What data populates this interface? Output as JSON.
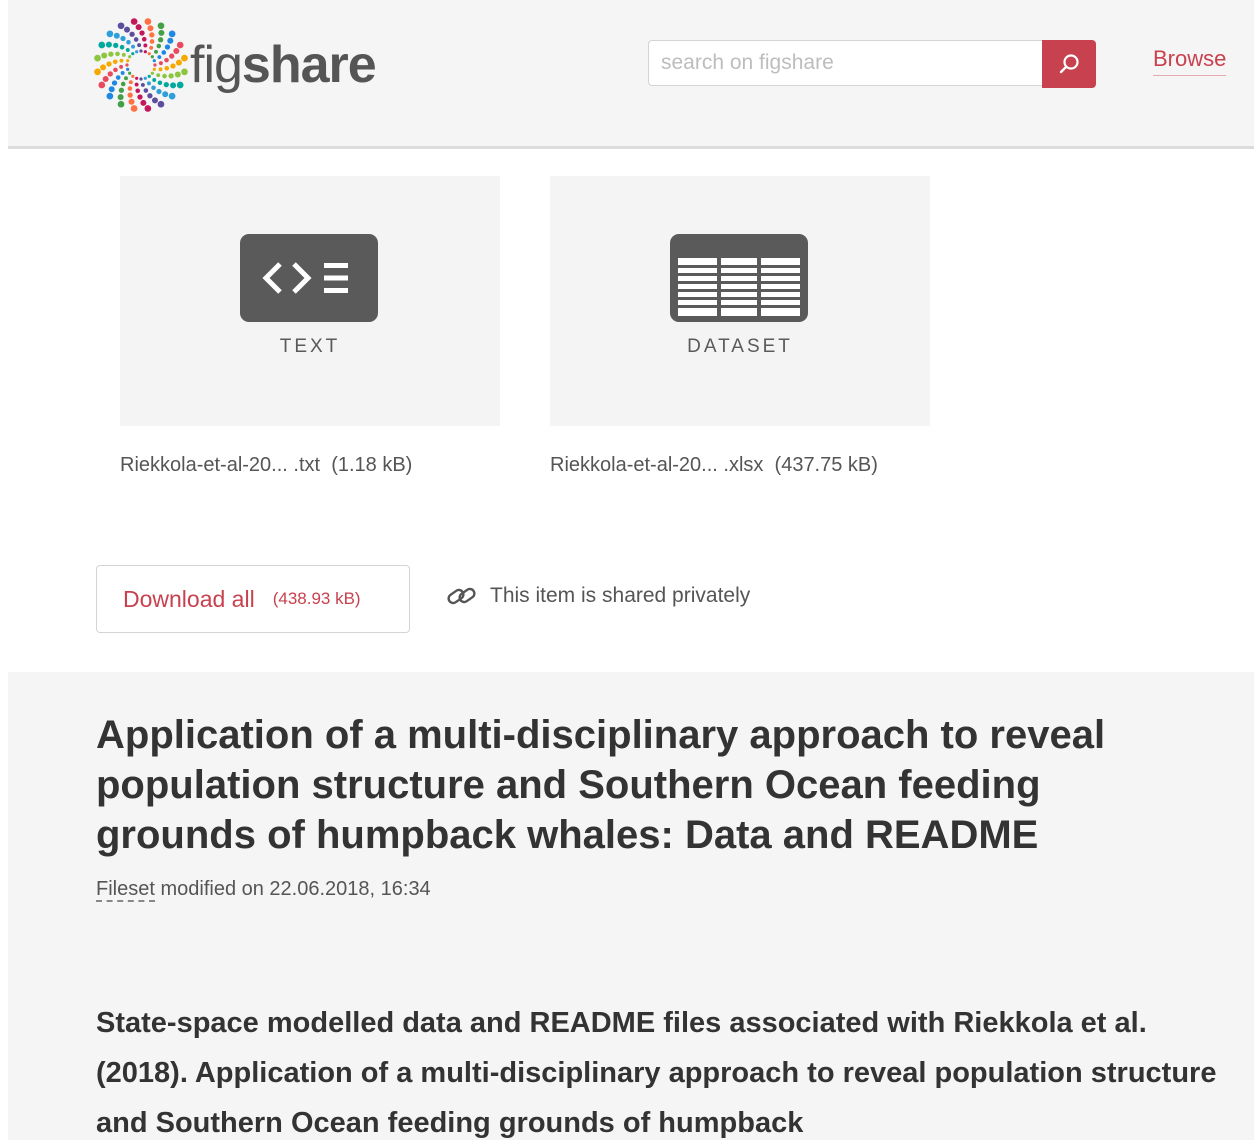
{
  "header": {
    "logo": {
      "fig": "fig",
      "share": "share"
    },
    "search": {
      "placeholder": "search on figshare"
    },
    "browse_label": "Browse"
  },
  "files": [
    {
      "type_label": "TEXT",
      "icon": "code-file-icon",
      "name": "Riekkola-et-al-20... .txt",
      "size": "(1.18 kB)"
    },
    {
      "type_label": "DATASET",
      "icon": "spreadsheet-icon",
      "name": "Riekkola-et-al-20... .xlsx",
      "size": "(437.75 kB)"
    }
  ],
  "actions": {
    "download_label": "Download all",
    "download_size": "(438.93 kB)",
    "shared_text": "This item is shared privately",
    "shared_icon": "link-icon"
  },
  "item": {
    "title": "Application of a multi-disciplinary approach to reveal population structure and Southern Ocean feeding grounds of humpback whales: Data and README",
    "type": "Fileset",
    "modified": "modified on 22.06.2018, 16:34",
    "description": "State-space modelled data and README files associated with Riekkola et al. (2018). Application of a multi-disciplinary approach to reveal population structure and Southern Ocean feeding grounds of humpback"
  },
  "colors": {
    "accent": "#c8414e",
    "icon_gray": "#5a5a5a",
    "panel_bg": "#f5f5f5"
  }
}
